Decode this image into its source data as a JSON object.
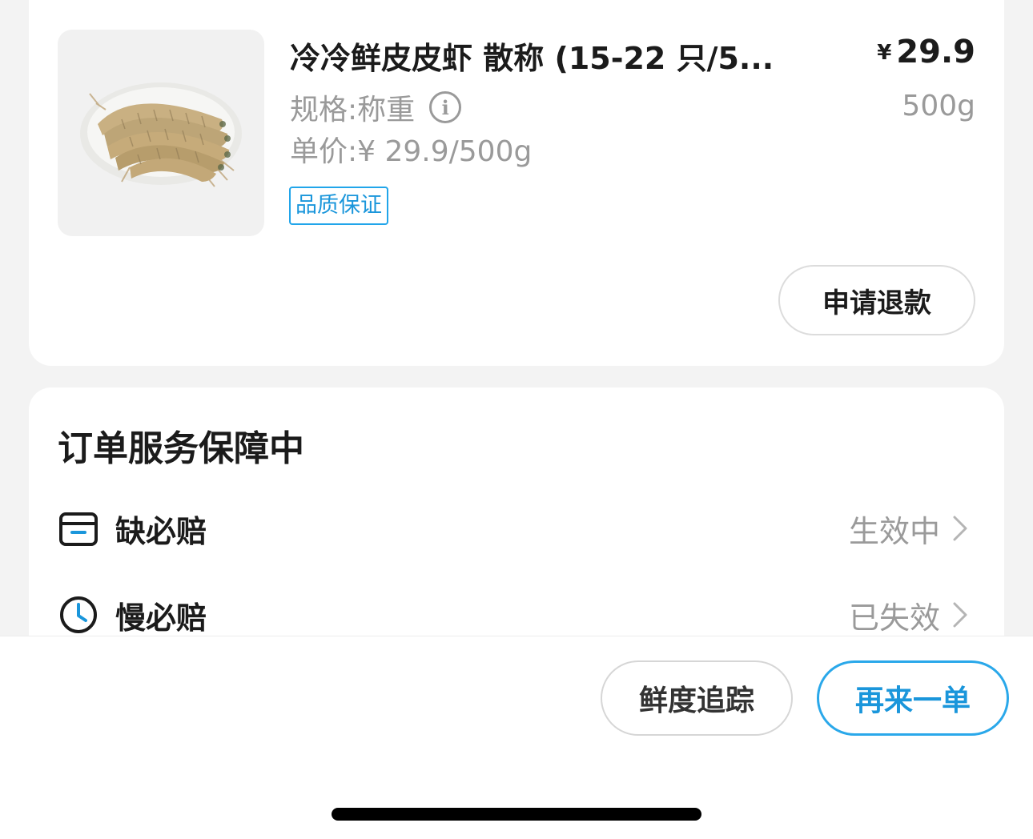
{
  "product": {
    "title": "冷冷鲜皮皮虾 散称 (15-22 只/5...",
    "currency_symbol": "¥",
    "price": "29.9",
    "weight": "500g",
    "spec": "规格:称重",
    "unit_price": "单价:¥ 29.9/500g",
    "badge": "品质保证",
    "refund_button": "申请退款",
    "image_alt": "mantis-shrimp-photo"
  },
  "service": {
    "title": "订单服务保障中",
    "rows": [
      {
        "label": "缺必赔",
        "status": "生效中",
        "icon": "box-icon"
      },
      {
        "label": "慢必赔",
        "status": "已失效",
        "icon": "clock-icon"
      }
    ]
  },
  "actions": {
    "fresh_tracking": "鲜度追踪",
    "order_again": "再来一单"
  },
  "colors": {
    "accent": "#1a96db",
    "muted_text": "#9a9a9a",
    "background": "#f3f3f3"
  }
}
